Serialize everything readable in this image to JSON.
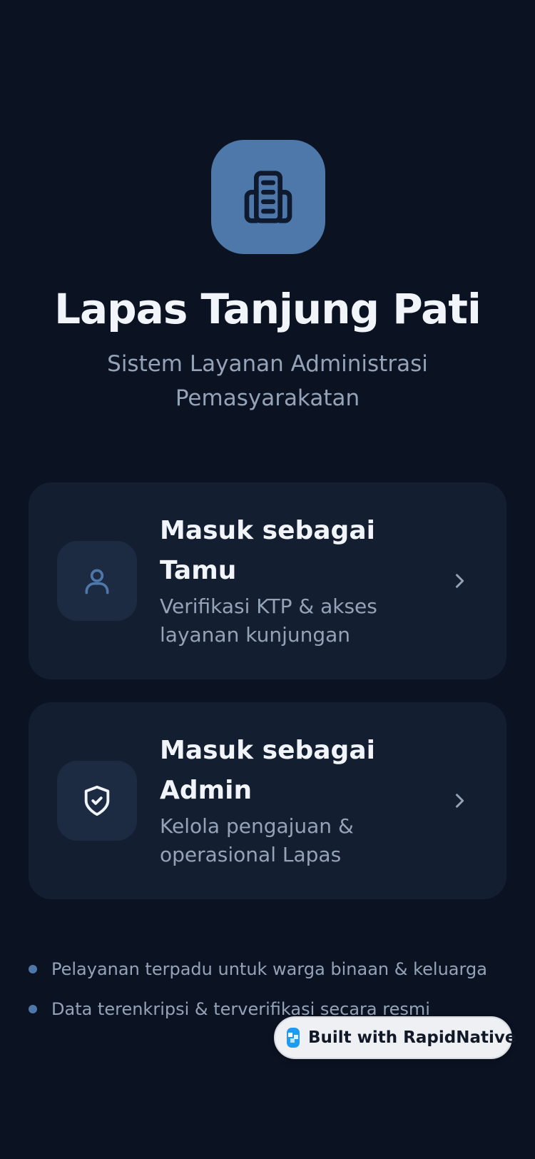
{
  "app": {
    "title": "Lapas Tanjung Pati",
    "subtitle": "Sistem Layanan Administrasi Pemasyarakatan",
    "logo_icon": "building-icon",
    "accent_color": "#4f78aa"
  },
  "roles": [
    {
      "title": "Masuk sebagai Tamu",
      "description": "Verifikasi KTP & akses layanan kunjungan",
      "icon": "user-icon"
    },
    {
      "title": "Masuk sebagai Admin",
      "description": "Kelola pengajuan & operasional Lapas",
      "icon": "shield-check-icon"
    }
  ],
  "features": [
    "Pelayanan terpadu untuk warga binaan & keluarga",
    "Data terenkripsi & terverifikasi secara resmi"
  ],
  "badge": {
    "label": "Built with RapidNative"
  },
  "colors": {
    "background": "#0b1221",
    "card": "#141e31",
    "icon_box": "#1c2a42"
  }
}
